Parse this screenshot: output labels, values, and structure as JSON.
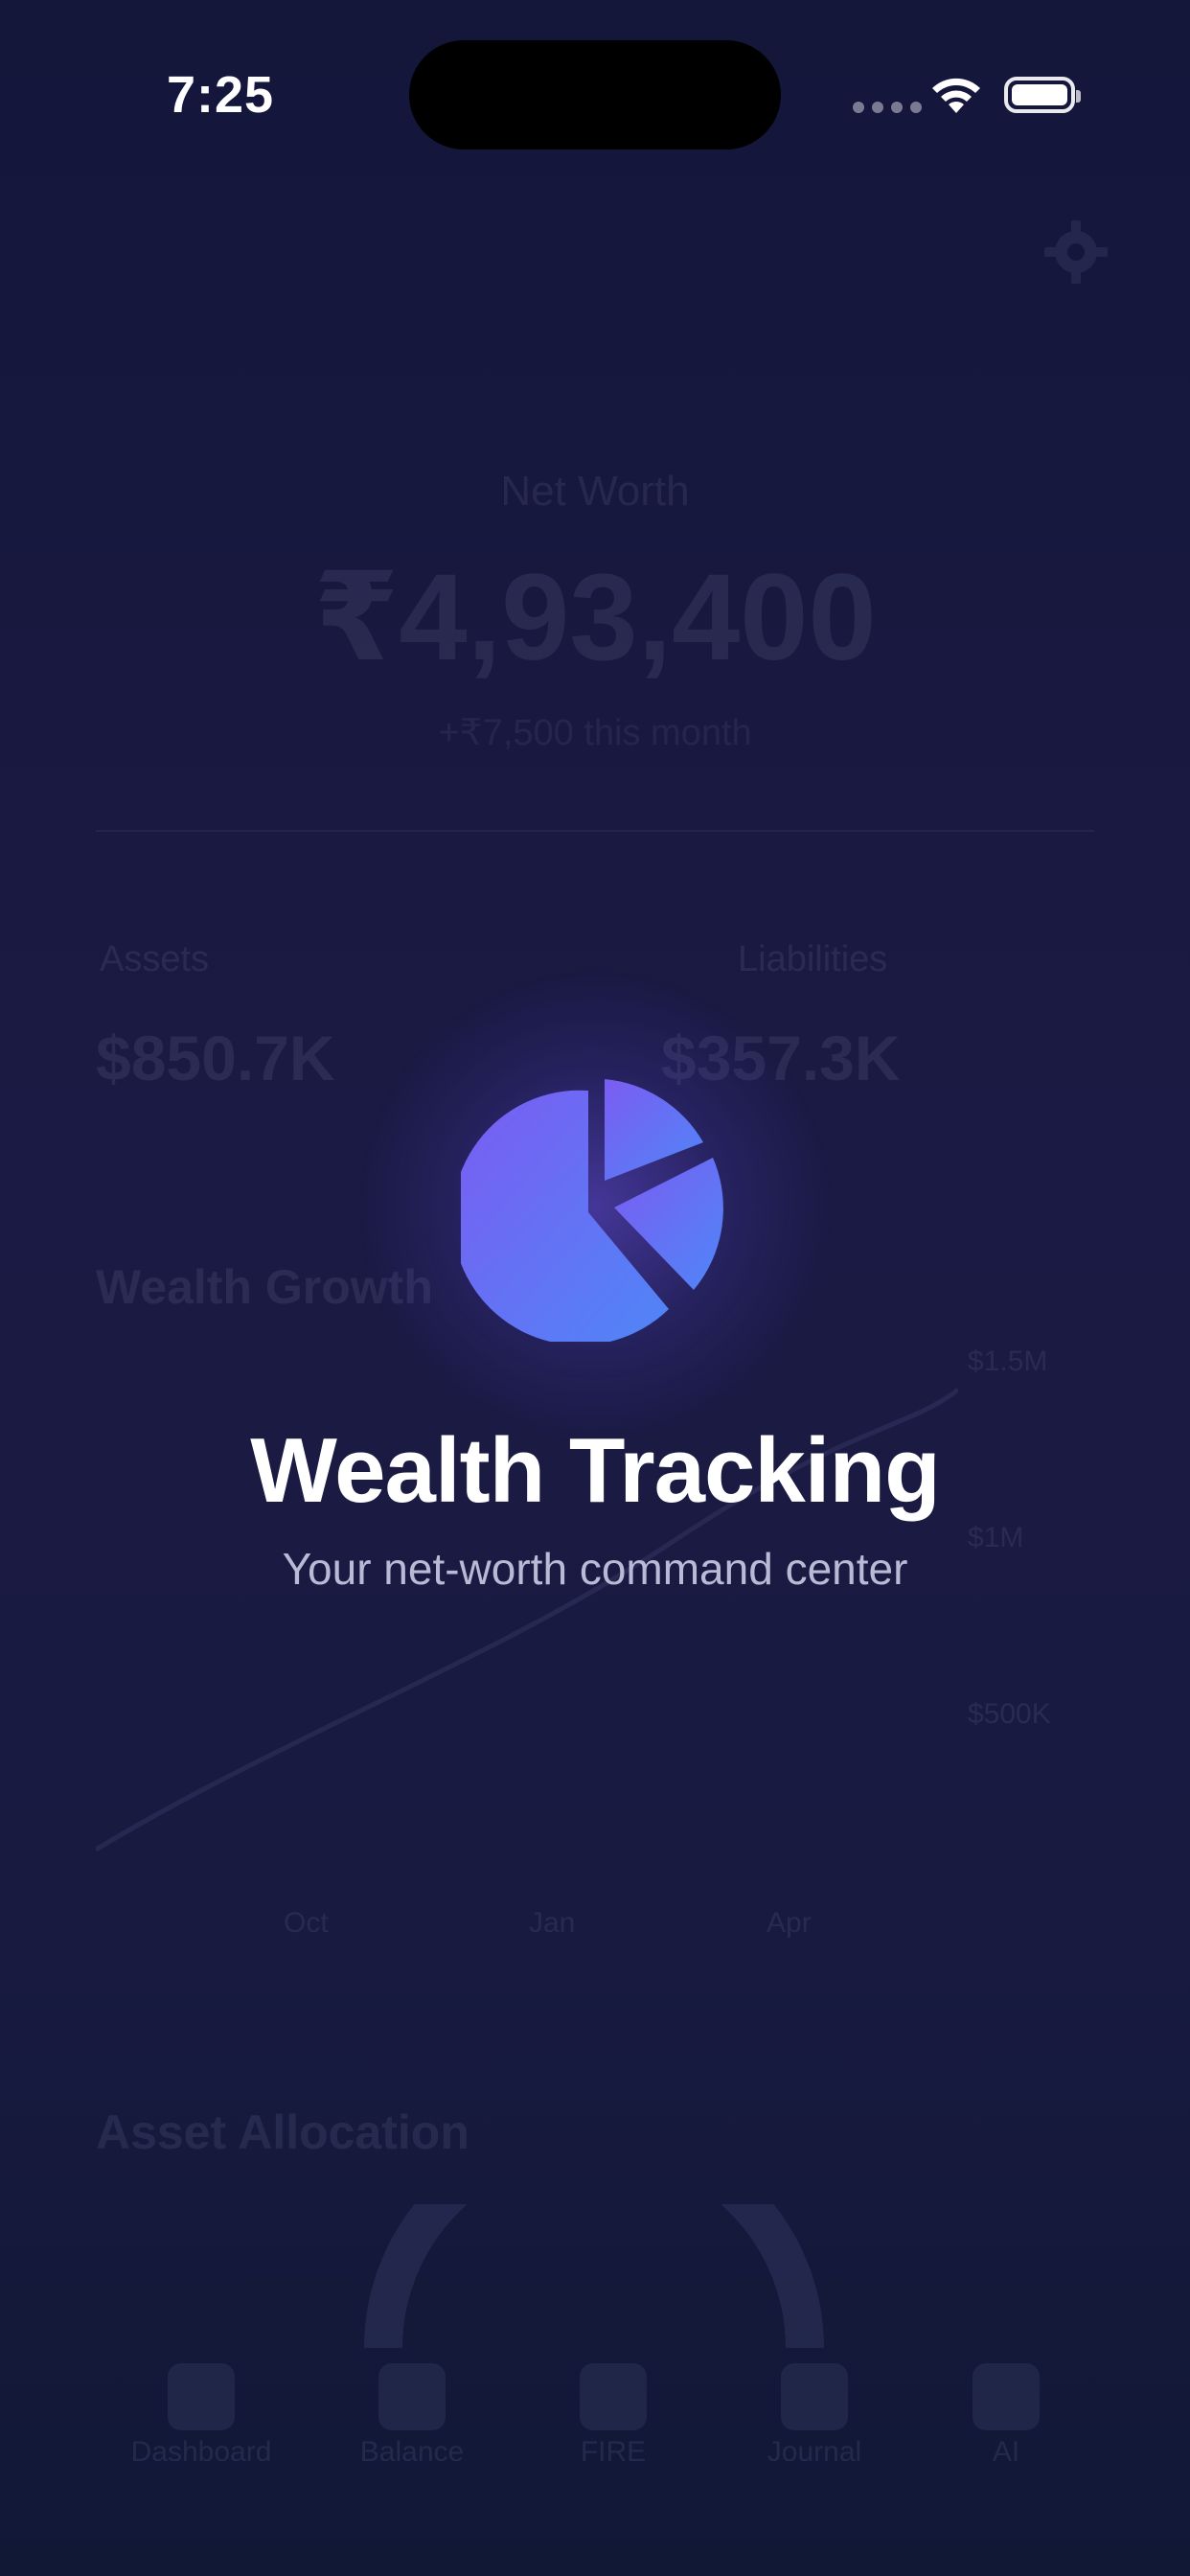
{
  "status_bar": {
    "time": "7:25"
  },
  "dashboard": {
    "net_worth_label": "Net Worth",
    "net_worth_value": "₹4,93,400",
    "net_worth_change": "+₹7,500 this month",
    "assets_label": "Assets",
    "assets_value": "$850.7K",
    "liabilities_label": "Liabilities",
    "liabilities_value": "$357.3K",
    "growth_title": "Wealth Growth",
    "y_ticks": [
      "$1.5M",
      "$1M",
      "$500K"
    ],
    "x_ticks": [
      "Oct",
      "Jan",
      "Apr"
    ],
    "allocation_title": "Asset Allocation"
  },
  "tabs": [
    {
      "label": "Dashboard",
      "icon": "dashboard-icon"
    },
    {
      "label": "Balance",
      "icon": "balance-icon"
    },
    {
      "label": "FIRE",
      "icon": "flame-icon"
    },
    {
      "label": "Journal",
      "icon": "book-icon"
    },
    {
      "label": "AI",
      "icon": "sparkle-icon"
    }
  ],
  "splash": {
    "title": "Wealth Tracking",
    "subtitle": "Your net-worth command center",
    "logo_icon": "pie-chart-icon"
  },
  "colors": {
    "background": "#1b1a44",
    "logo_start": "#7b5cf2",
    "logo_end": "#4f86f7",
    "subtitle": "#b9bbd6"
  }
}
